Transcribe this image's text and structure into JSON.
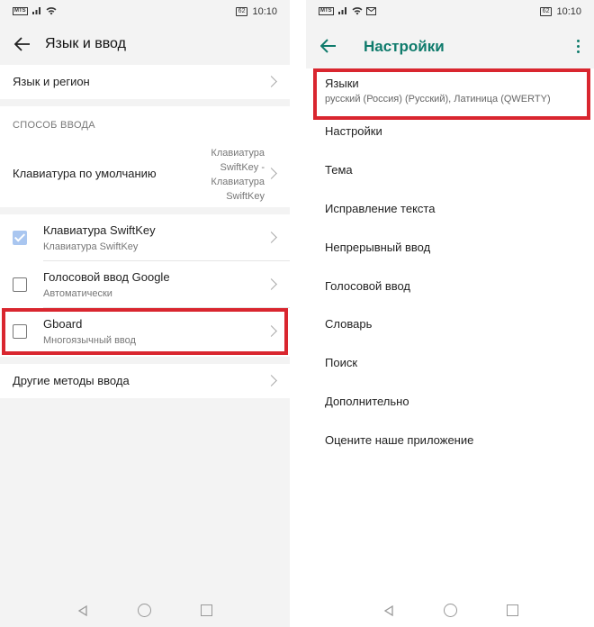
{
  "status_bar": {
    "sim": "MTS",
    "battery": "62",
    "time": "10:10"
  },
  "left": {
    "title": "Язык и ввод",
    "language_region": "Язык и регион",
    "section_input_method": "СПОСОБ ВВОДА",
    "default_keyboard": {
      "label": "Клавиатура по умолчанию",
      "value_lines": [
        "Клавиатура",
        "SwiftKey -",
        "Клавиатура",
        "SwiftKey"
      ]
    },
    "keyboards": [
      {
        "title": "Клавиатура SwiftKey",
        "subtitle": "Клавиатура SwiftKey",
        "checked": true
      },
      {
        "title": "Голосовой ввод Google",
        "subtitle": "Автоматически",
        "checked": false
      },
      {
        "title": "Gboard",
        "subtitle": "Многоязычный ввод",
        "checked": false
      }
    ],
    "other_methods": "Другие методы ввода"
  },
  "right": {
    "title": "Настройки",
    "languages": {
      "title": "Языки",
      "subtitle": "русский (Россия) (Русский), Латиница (QWERTY)"
    },
    "items": [
      "Настройки",
      "Тема",
      "Исправление текста",
      "Непрерывный ввод",
      "Голосовой ввод",
      "Словарь",
      "Поиск",
      "Дополнительно",
      "Оцените наше приложение"
    ]
  },
  "colors": {
    "accent": "#0f7b6c",
    "highlight": "#d9262f",
    "checkbox_checked": "#a9c6f0"
  }
}
